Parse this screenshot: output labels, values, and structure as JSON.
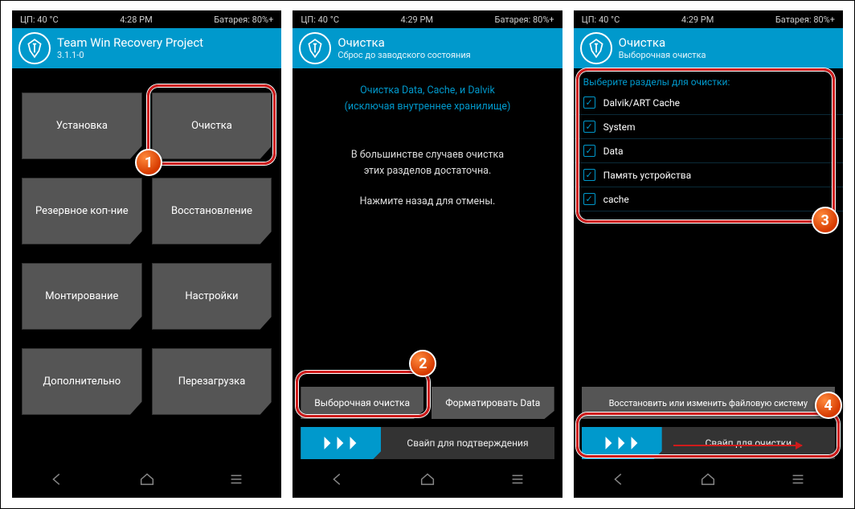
{
  "panel1": {
    "status": {
      "cpu": "ЦП: 40 °C",
      "time": "4:28 PM",
      "battery": "Батарея: 80%+"
    },
    "header_title": "Team Win Recovery Project",
    "header_sub": "3.1.1-0",
    "tiles": [
      "Установка",
      "Очистка",
      "Резервное коп-ние",
      "Восстановление",
      "Монтирование",
      "Настройки",
      "Дополнительно",
      "Перезагрузка"
    ]
  },
  "panel2": {
    "status": {
      "cpu": "ЦП: 40 °C",
      "time": "4:29 PM",
      "battery": "Батарея: 80%+"
    },
    "header_title": "Очистка",
    "header_sub": "Сброс до заводского состояния",
    "link1": "Очистка Data, Cache, и Dalvik",
    "link2": "(исключая внутреннее хранилище)",
    "info1": "В большинстве случаев очистка",
    "info2": "этих разделов достаточна.",
    "info3": "Нажмите назад для отмены.",
    "btn_selective": "Выборочная очистка",
    "btn_format": "Форматировать Data",
    "swipe_label": "Свайп для подтверждения"
  },
  "panel3": {
    "status": {
      "cpu": "ЦП: 40 °C",
      "time": "4:29 PM",
      "battery": "Батарея: 80%+"
    },
    "header_title": "Очистка",
    "header_sub": "Выборочная очистка",
    "section_title": "Выберите разделы для очистки:",
    "partitions": [
      "Dalvik/ART Cache",
      "System",
      "Data",
      "Память устройства",
      "cache"
    ],
    "btn_repair": "Восстановить или изменить файловую систему",
    "swipe_label": "Свайп для очистки"
  },
  "badges": {
    "b1": "1",
    "b2": "2",
    "b3": "3",
    "b4": "4"
  }
}
